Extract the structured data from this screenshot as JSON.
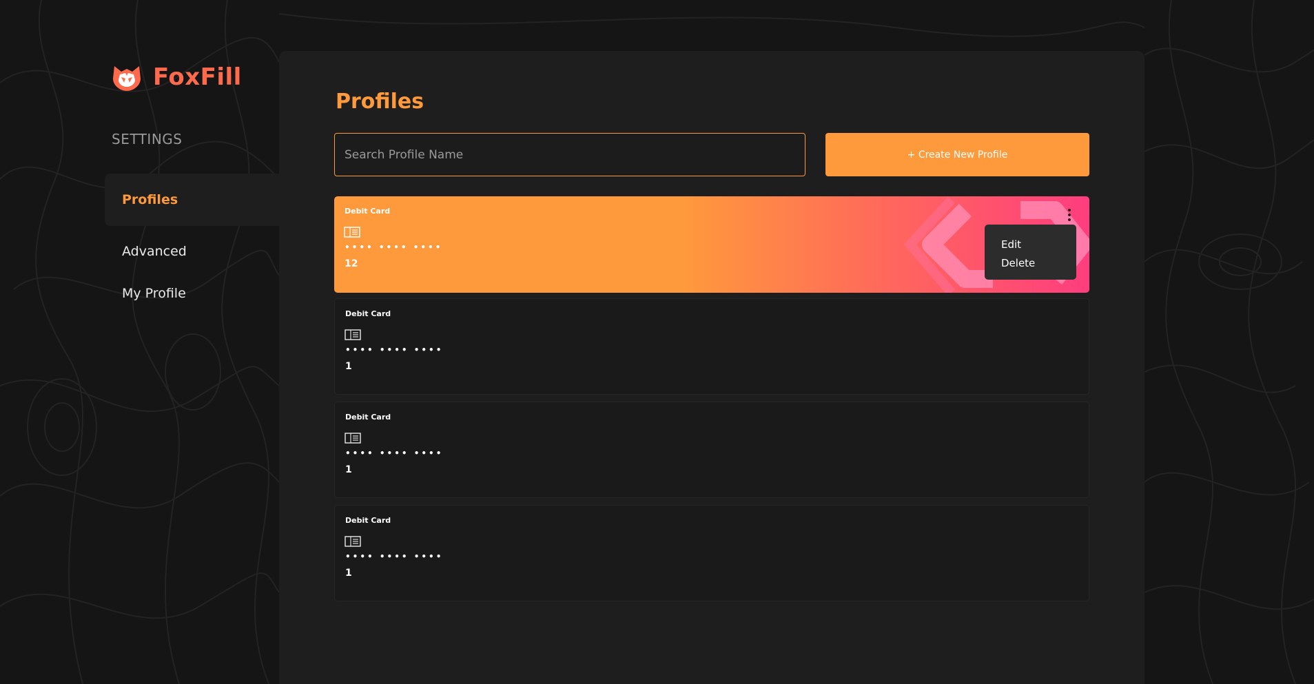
{
  "brand": {
    "name": "FoxFill"
  },
  "sidebar": {
    "heading": "SETTINGS",
    "items": [
      {
        "label": "Profiles",
        "active": true
      },
      {
        "label": "Advanced",
        "active": false
      },
      {
        "label": "My Profile",
        "active": false
      }
    ]
  },
  "main": {
    "title": "Profiles",
    "search": {
      "placeholder": "Search Profile Name",
      "value": ""
    },
    "create_button": "+ Create New Profile",
    "cards": [
      {
        "type": "Debit Card",
        "masked": "•••• •••• ••••",
        "count": "12",
        "highlighted": true
      },
      {
        "type": "Debit Card",
        "masked": "•••• •••• ••••",
        "count": "1",
        "highlighted": false
      },
      {
        "type": "Debit Card",
        "masked": "•••• •••• ••••",
        "count": "1",
        "highlighted": false
      },
      {
        "type": "Debit Card",
        "masked": "•••• •••• ••••",
        "count": "1",
        "highlighted": false
      }
    ],
    "context_menu": {
      "items": [
        "Edit",
        "Delete"
      ]
    }
  },
  "colors": {
    "accent": "#ff9a3c",
    "brand": "#ff6a4d",
    "gradient_end": "#ff3d7f",
    "background": "#151515",
    "panel": "#1e1e1e"
  },
  "icons": {
    "logo": "fox-logo-icon",
    "card": "card-icon",
    "menu": "kebab-menu-icon"
  }
}
